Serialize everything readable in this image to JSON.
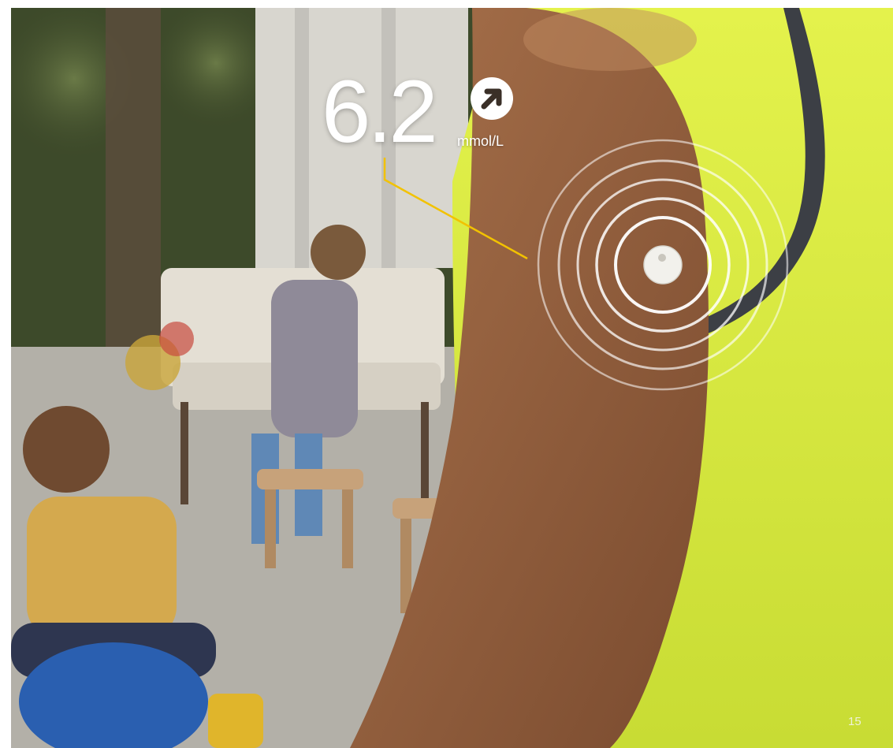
{
  "photo": {
    "description_icon": "photo-scene"
  },
  "reading": {
    "value": "6.2",
    "unit": "mmol/L",
    "trend_icon": "arrow-up-right-icon"
  },
  "page": {
    "number": "15"
  },
  "colors": {
    "connector_line": "#f2c200",
    "shirt": "#d9ef3f",
    "rings": "#ffffff"
  }
}
